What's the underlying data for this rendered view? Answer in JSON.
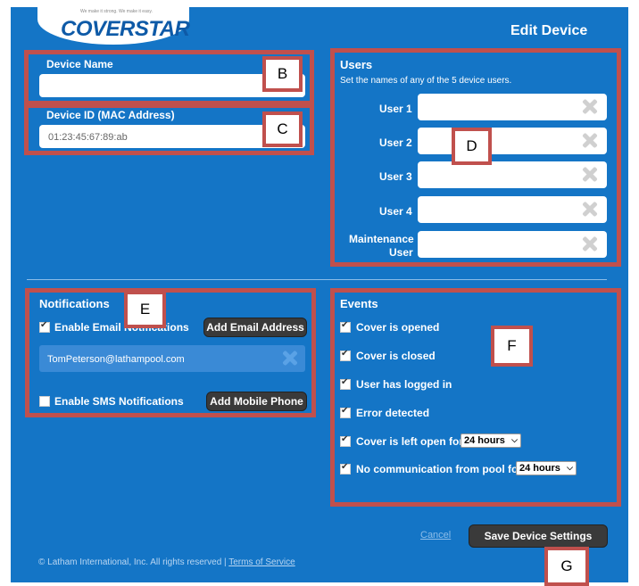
{
  "header": {
    "logo_text": "COVERSTAR",
    "logo_tagline": "We make it strong. We make it easy.",
    "title": "Edit Device"
  },
  "device": {
    "name_label": "Device Name",
    "name_value": "",
    "id_label": "Device ID (MAC Address)",
    "id_value": "01:23:45:67:89:ab"
  },
  "users": {
    "heading": "Users",
    "subtitle": "Set the names of any of the 5 device users.",
    "items": [
      {
        "label": "User 1",
        "value": ""
      },
      {
        "label": "User 2",
        "value": ""
      },
      {
        "label": "User 3",
        "value": ""
      },
      {
        "label": "User 4",
        "value": ""
      },
      {
        "label_line1": "Maintenance",
        "label_line2": "User",
        "value": ""
      }
    ]
  },
  "notifications": {
    "heading": "Notifications",
    "email_toggle_label": "Enable Email Notifications",
    "email_checked": true,
    "add_email_button": "Add Email Address",
    "emails": [
      "TomPeterson@lathampool.com"
    ],
    "sms_toggle_label": "Enable SMS Notifications",
    "sms_checked": false,
    "add_phone_button": "Add Mobile Phone"
  },
  "events": {
    "heading": "Events",
    "items": [
      {
        "label": "Cover is opened",
        "checked": true
      },
      {
        "label": "Cover is closed",
        "checked": true
      },
      {
        "label": "User has logged in",
        "checked": true
      },
      {
        "label": "Error detected",
        "checked": true
      },
      {
        "label": "Cover is left open for",
        "checked": true,
        "select": "24 hours"
      },
      {
        "label": "No communication from pool for",
        "checked": true,
        "select": "24 hours"
      }
    ]
  },
  "actions": {
    "cancel_label": "Cancel",
    "save_label": "Save Device Settings"
  },
  "footer": {
    "copyright": "© Latham International, Inc. All rights reserved | ",
    "terms_label": "Terms of Service"
  },
  "callout_labels": {
    "b": "B",
    "c": "C",
    "d": "D",
    "e": "E",
    "f": "F",
    "g": "G"
  },
  "colors": {
    "panel": "#1475c6",
    "callout": "#c0504d",
    "button": "#3a3a3a"
  }
}
